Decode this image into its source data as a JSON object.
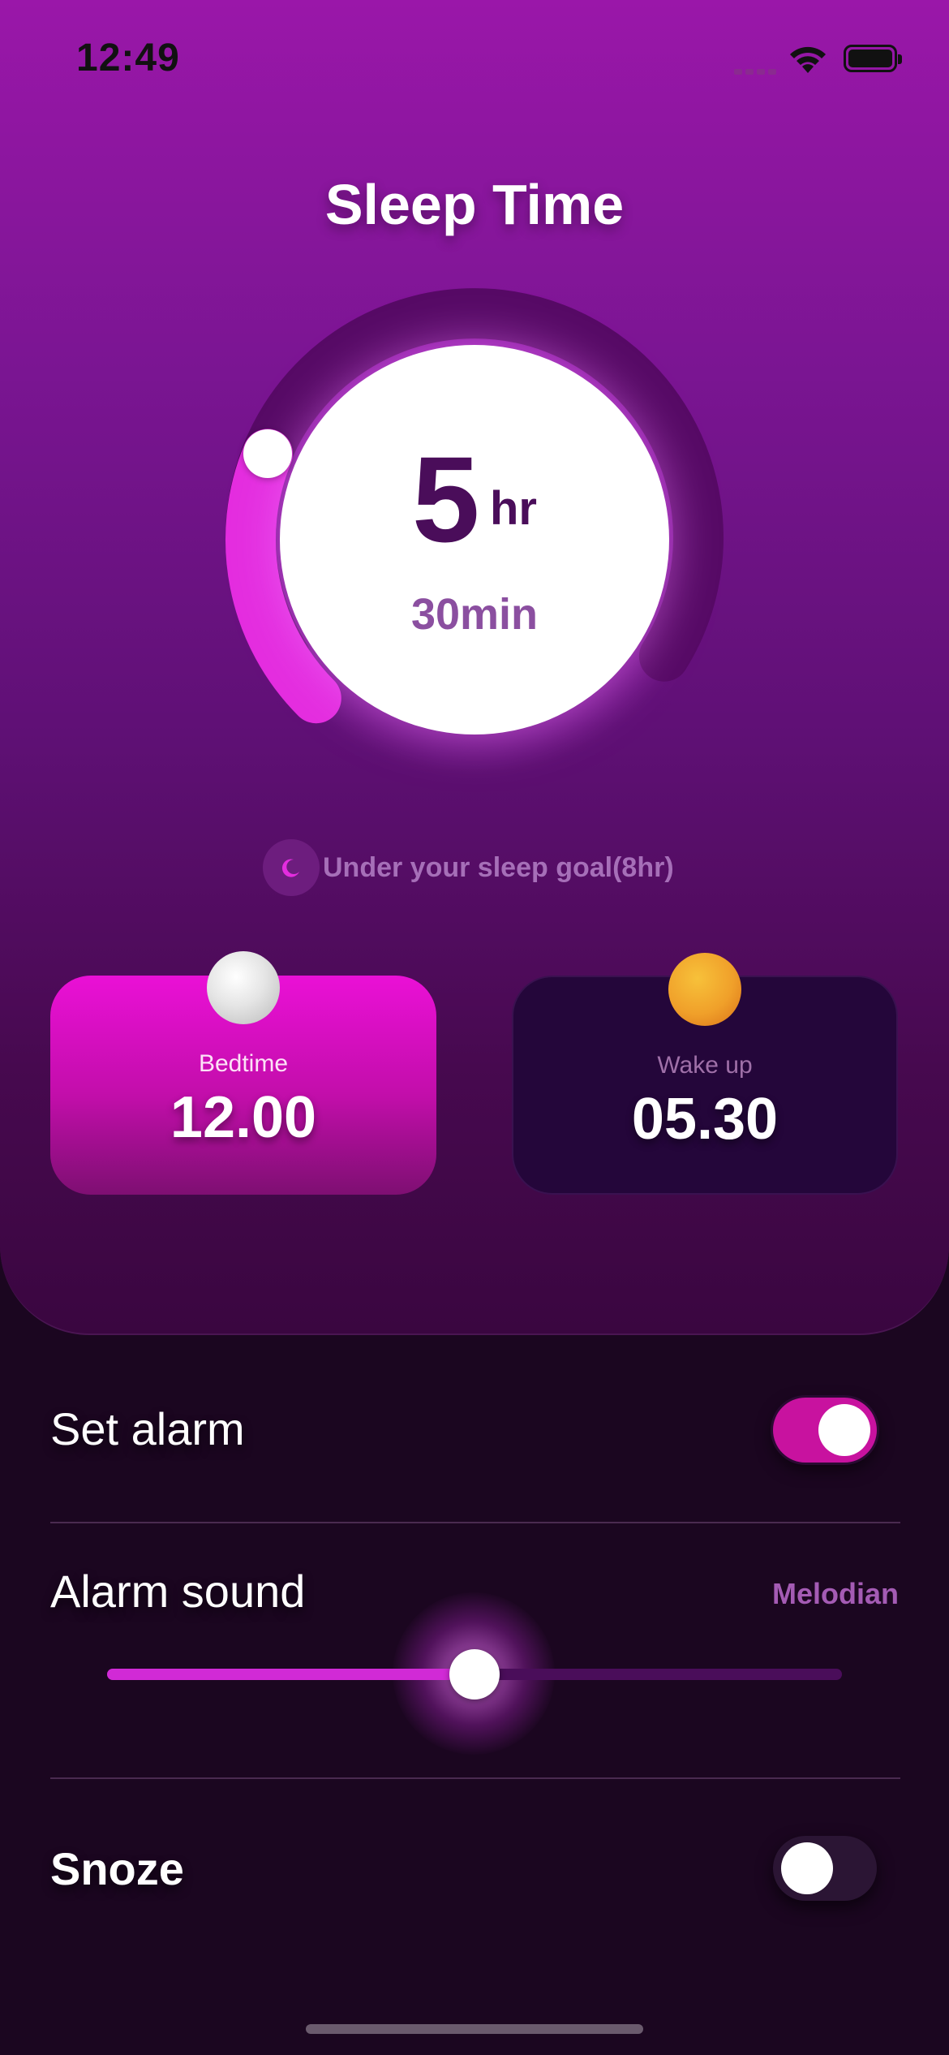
{
  "status_bar": {
    "time": "12:49"
  },
  "header": {
    "title": "Sleep Time"
  },
  "dial": {
    "hours": "5",
    "hours_unit": "hr",
    "minutes": "30min",
    "progress_fraction": 0.25
  },
  "goal": {
    "text": "Under your sleep goal(8hr)",
    "icon": "moon-icon"
  },
  "cards": {
    "bedtime": {
      "label": "Bedtime",
      "time": "12.00",
      "icon": "moon-orb-icon"
    },
    "wakeup": {
      "label": "Wake up",
      "time": "05.30",
      "icon": "sun-orb-icon"
    }
  },
  "settings": {
    "set_alarm": {
      "label": "Set alarm",
      "enabled": true
    },
    "alarm_sound": {
      "label": "Alarm sound",
      "value": "Melodian",
      "volume_fraction": 0.5
    },
    "snooze": {
      "label": "Snoze",
      "enabled": false
    }
  },
  "colors": {
    "accent": "#d12ad6",
    "panel_top": "#9a17a9",
    "background": "#1b0620"
  }
}
